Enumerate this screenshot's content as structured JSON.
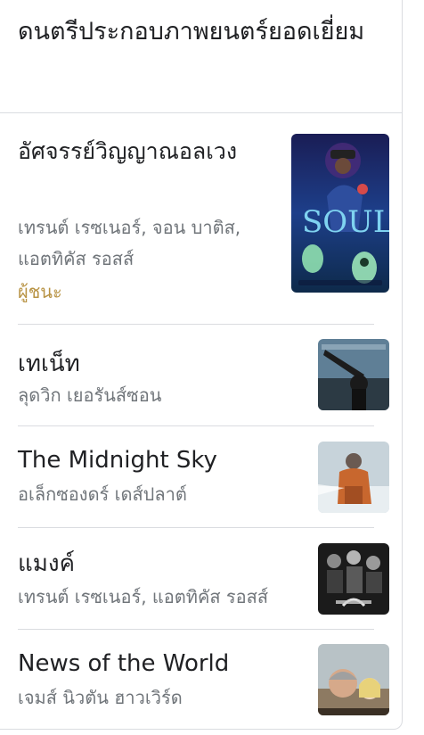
{
  "header": {
    "title": "ดนตรีประกอบภาพยนตร์ยอดเยี่ยม"
  },
  "winner": {
    "title": "อัศจรรย์วิญญาณอลเวง",
    "credits": "เทรนต์ เรซเนอร์, จอน บาติส, แอตทิคัส รอสส์",
    "badge": "ผู้ชนะ",
    "poster": "soul-poster"
  },
  "nominees": [
    {
      "title": "เทเน็ท",
      "credits": "ลุดวิก เยอรันส์ซอน",
      "poster": "tenet-poster"
    },
    {
      "title": "The Midnight Sky",
      "credits": "อเล็กซองดร์ เดส์ปลาต์",
      "poster": "midnight-sky-poster"
    },
    {
      "title": "แมงค์",
      "credits": "เทรนต์ เรซเนอร์, แอตทิคัส รอสส์",
      "poster": "mank-poster"
    },
    {
      "title": "News of the World",
      "credits": "เจมส์ นิวตัน ฮาวเวิร์ด",
      "poster": "news-of-the-world-poster"
    }
  ],
  "colors": {
    "text_primary": "#202124",
    "text_secondary": "#70757a",
    "winner_gold": "#b89344",
    "divider": "#dadce0"
  }
}
